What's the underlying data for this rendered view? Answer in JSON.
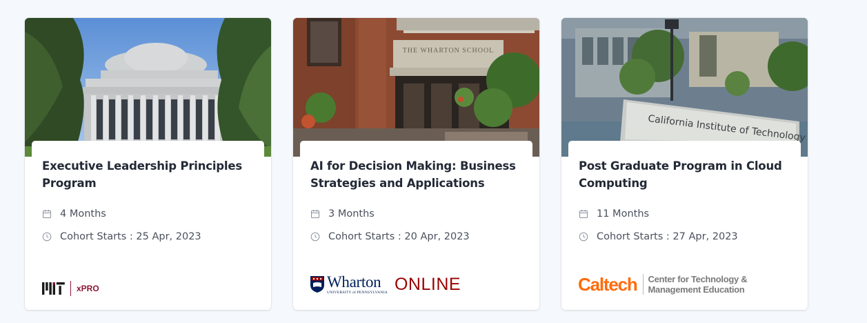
{
  "cards": [
    {
      "title": "Executive Leadership Principles Program",
      "duration": "4 Months",
      "cohort": "Cohort Starts : 25 Apr, 2023",
      "image": "mit-great-dome-building",
      "logo": {
        "org": "MIT",
        "text": "xPRO",
        "color": "#8a1538"
      }
    },
    {
      "title": "AI for Decision Making: Business Strategies and Applications",
      "duration": "3 Months",
      "cohort": "Cohort Starts : 20 Apr, 2023",
      "image": "wharton-school-brick-building",
      "image_sign": "THE WHARTON SCHOOL",
      "logo": {
        "name": "Wharton",
        "subtitle": "UNIVERSITY of PENNSYLVANIA",
        "suffix": "ONLINE",
        "color": "#990000"
      }
    },
    {
      "title": "Post Graduate Program in Cloud Computing",
      "duration": "11 Months",
      "cohort": "Cohort Starts : 27 Apr, 2023",
      "image": "caltech-entrance-sign",
      "image_sign": "California Institute of Technology",
      "logo": {
        "name": "Caltech",
        "tagline_1": "Center for Technology &",
        "tagline_2": "Management Education",
        "color": "#ff6c0c"
      }
    }
  ],
  "icons": {
    "duration": "calendar-icon",
    "cohort": "clock-icon"
  }
}
